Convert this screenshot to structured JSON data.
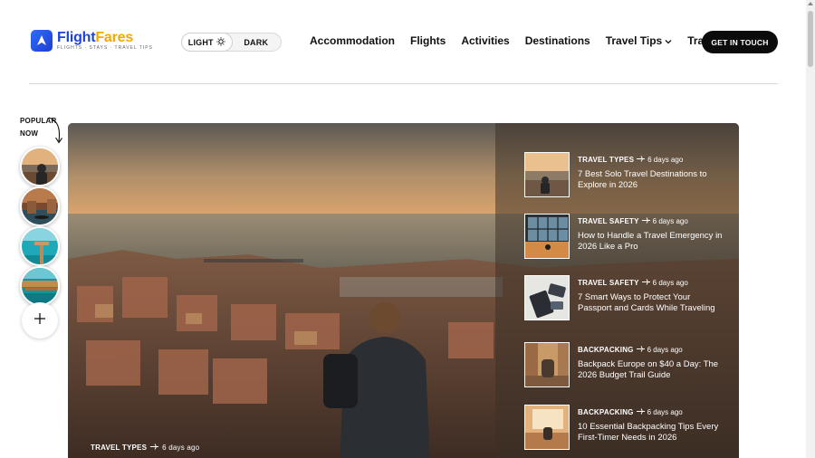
{
  "header": {
    "brand_part1": "Flight",
    "brand_part2": "Fares",
    "tagline": "FLIGHTS · STAYS · TRAVEL TIPS",
    "theme": {
      "light_label": "LIGHT",
      "dark_label": "DARK",
      "active": "light"
    },
    "nav": [
      {
        "label": "Accommodation",
        "dropdown": false
      },
      {
        "label": "Flights",
        "dropdown": false
      },
      {
        "label": "Activities",
        "dropdown": false
      },
      {
        "label": "Destinations",
        "dropdown": false
      },
      {
        "label": "Travel Tips",
        "dropdown": true
      },
      {
        "label": "Travel Types",
        "dropdown": false
      }
    ],
    "cta_label": "GET IN TOUCH"
  },
  "popular": {
    "label_line1": "POPULAR",
    "label_line2": "NOW",
    "thumbnails": [
      "solo-traveler-sunset",
      "venice-canal",
      "tropical-pier",
      "island-resort"
    ],
    "add_icon": "plus-icon"
  },
  "hero": {
    "category": "TRAVEL TYPES",
    "time_ago": "6 days ago"
  },
  "articles": [
    {
      "category": "TRAVEL TYPES",
      "time_ago": "6 days ago",
      "title": "7 Best Solo Travel Destinations to Explore in 2026"
    },
    {
      "category": "TRAVEL SAFETY",
      "time_ago": "6 days ago",
      "title": "How to Handle a Travel Emergency in 2026 Like a Pro"
    },
    {
      "category": "TRAVEL SAFETY",
      "time_ago": "6 days ago",
      "title": "7 Smart Ways to Protect Your Passport and Cards While Traveling"
    },
    {
      "category": "BACKPACKING",
      "time_ago": "6 days ago",
      "title": "Backpack Europe on $40 a Day: The 2026 Budget Trail Guide"
    },
    {
      "category": "BACKPACKING",
      "time_ago": "6 days ago",
      "title": "10 Essential Backpacking Tips Every First-Timer Needs in 2026"
    }
  ],
  "colors": {
    "brand_blue": "#1e43d8",
    "brand_yellow": "#f2a900",
    "cta_bg": "#0b0b0b"
  }
}
